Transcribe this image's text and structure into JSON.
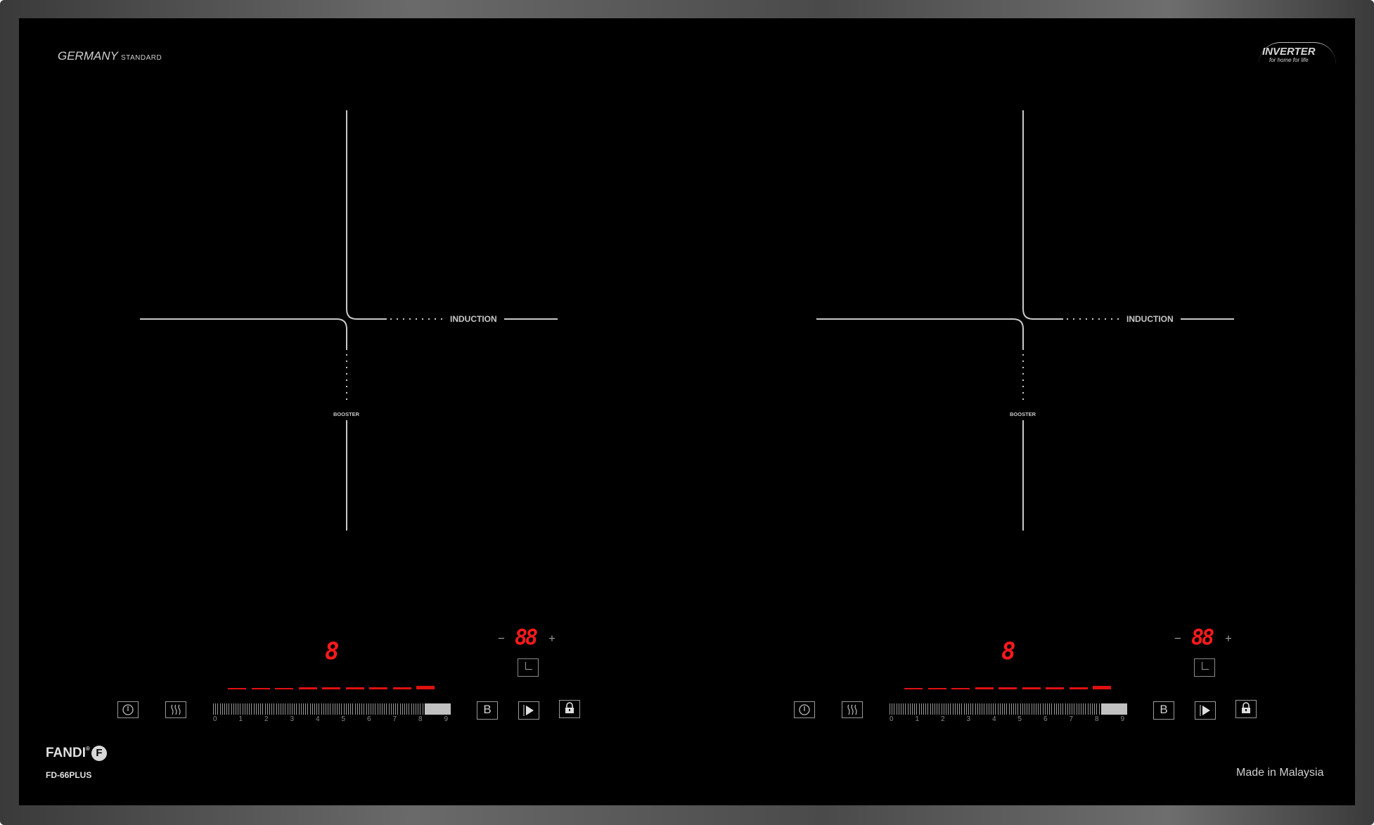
{
  "header": {
    "left_brand": "GERMANY",
    "left_brand_suffix": "STANDARD",
    "right_logo": "INVERTER",
    "right_logo_tagline": "for home for life"
  },
  "zones": [
    {
      "label": "INDUCTION",
      "booster_label": "BOOSTER",
      "power_display": "8",
      "timer_display": "88",
      "minus": "−",
      "plus": "+"
    },
    {
      "label": "INDUCTION",
      "booster_label": "BOOSTER",
      "power_display": "8",
      "timer_display": "88",
      "minus": "−",
      "plus": "+"
    }
  ],
  "controls": {
    "power_icon": "power-icon",
    "heat_icon": "heat-waves-icon",
    "booster_key": "B",
    "play_icon": "play-icon",
    "lock_icon": "lock-icon",
    "slider_ticks": [
      "0",
      "1",
      "2",
      "3",
      "4",
      "5",
      "6",
      "7",
      "8",
      "9"
    ],
    "slider_level_fraction": 0.89,
    "level_bars_lit": 9
  },
  "footer": {
    "brand": "FANDI",
    "brand_mark": "F",
    "registered": "®",
    "model": "FD-66PLUS",
    "origin": "Made in Malaysia"
  },
  "colors": {
    "glass": "#000000",
    "display_red": "#ff1a1a",
    "markings": "#c8c8c8"
  }
}
